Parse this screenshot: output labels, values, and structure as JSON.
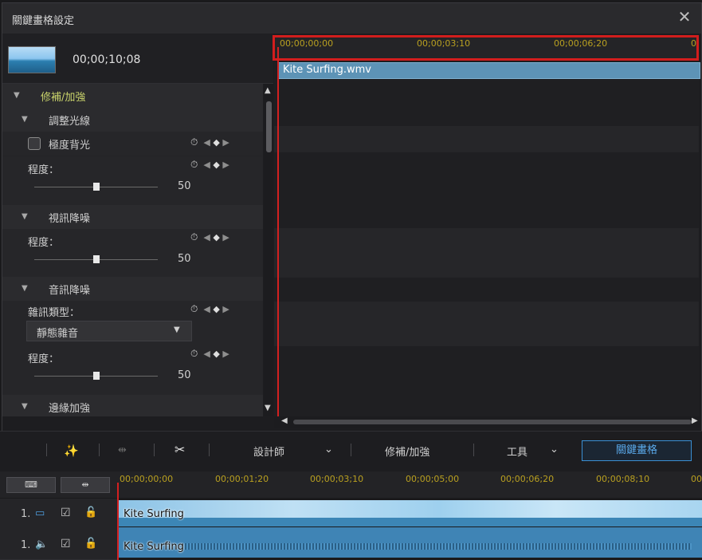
{
  "dialog": {
    "title": "關鍵畫格設定",
    "close_icon": "close-icon",
    "clip_time": "00;00;10;08",
    "ruler_ticks": [
      "00;00;00;00",
      "00;00;03;10",
      "00;00;06;20",
      "0"
    ],
    "clip_name": "Kite Surfing.wmv"
  },
  "panel": {
    "group_main": "修補/加強",
    "section_light": "調整光線",
    "extreme_backlight": "極度背光",
    "degree_label": "程度：",
    "light_value": "50",
    "section_video_noise": "視訊降噪",
    "video_noise_value": "50",
    "section_audio_noise": "音訊降噪",
    "noise_type_label": "雜訊類型：",
    "noise_type_selected": "靜態雜音",
    "audio_noise_value": "50",
    "section_edge": "邊緣加強"
  },
  "toolbar": {
    "designer": "設計師",
    "fix_enhance": "修補/加強",
    "tools": "工具",
    "keyframe": "關鍵畫格"
  },
  "timeline": {
    "ticks": [
      "00;00;00;00",
      "00;00;01;20",
      "00;00;03;10",
      "00;00;05;00",
      "00;00;06;20",
      "00;00;08;10",
      "00"
    ],
    "track1_num": "1.",
    "track2_num": "1.",
    "video_clip": "Kite Surfing",
    "audio_clip": "Kite Surfing"
  },
  "colors": {
    "accent_blue": "#3a8fd4",
    "playhead_red": "#d32020",
    "tick_gold": "#b9a020",
    "group_green": "#c9d36b"
  }
}
